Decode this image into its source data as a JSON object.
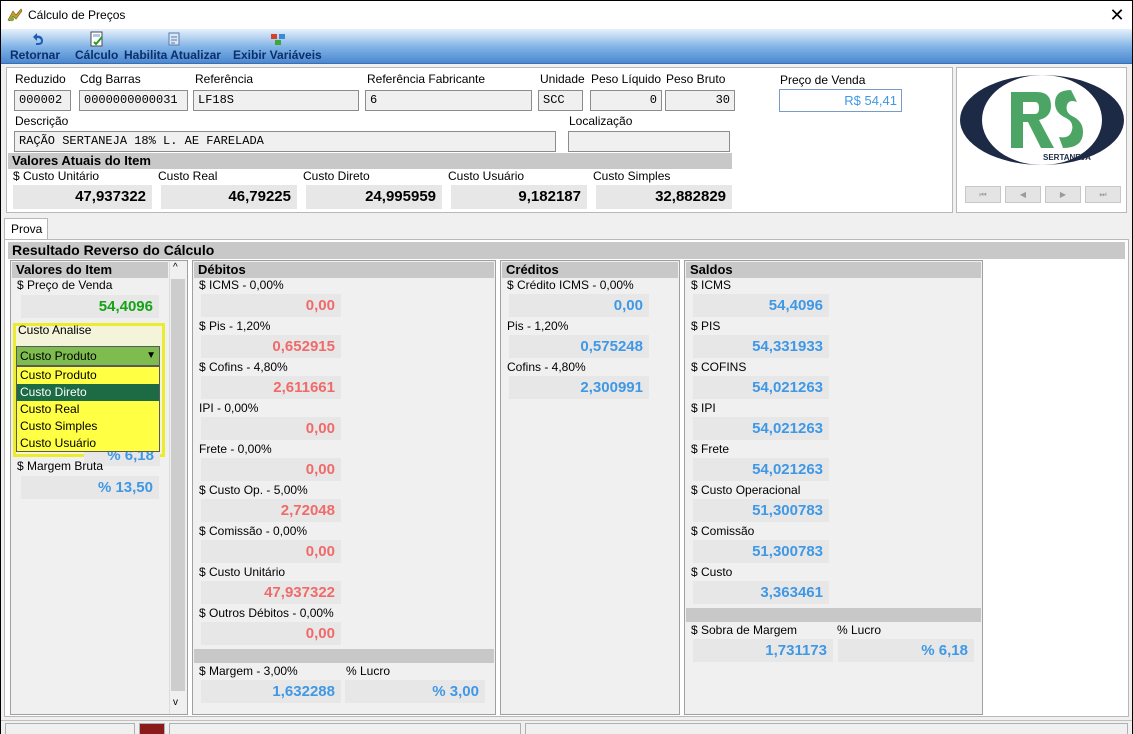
{
  "window": {
    "title": "Cálculo de Preços",
    "close_glyph": "✕"
  },
  "toolbar": [
    {
      "label": "Retornar",
      "icon": "return-arrow-icon"
    },
    {
      "label": "Cálculo",
      "icon": "calculator-icon"
    },
    {
      "label": "Habilita Atualizar",
      "icon": "enable-update-icon"
    },
    {
      "label": "Exibir Variáveis",
      "icon": "variables-icon"
    }
  ],
  "header": {
    "reduzido": {
      "label": "Reduzido",
      "value": "000002"
    },
    "cdg_barras": {
      "label": "Cdg Barras",
      "value": "0000000000031"
    },
    "referencia": {
      "label": "Referência",
      "value": "LF18S"
    },
    "ref_fabricante": {
      "label": "Referência Fabricante",
      "value": "6"
    },
    "unidade": {
      "label": "Unidade",
      "value": "SCC"
    },
    "peso_liquido": {
      "label": "Peso Líquido",
      "value": "0"
    },
    "peso_bruto": {
      "label": "Peso Bruto",
      "value": "30"
    },
    "preco_venda": {
      "label": "Preço de Venda",
      "value": "R$ 54,41"
    },
    "descricao": {
      "label": "Descrição",
      "value": "RAÇÃO SERTANEJA 18% L. AE FARELADA"
    },
    "localizacao": {
      "label": "Localização",
      "value": ""
    }
  },
  "valores_atuais": {
    "title": "Valores Atuais do Item",
    "items": [
      {
        "label": "$ Custo Unitário",
        "value": "47,937322"
      },
      {
        "label": "Custo Real",
        "value": "46,79225"
      },
      {
        "label": "Custo Direto",
        "value": "24,995959"
      },
      {
        "label": "Custo Usuário",
        "value": "9,182187"
      },
      {
        "label": "Custo Simples",
        "value": "32,882829"
      }
    ]
  },
  "logo": {
    "brand": "SERTANEJA"
  },
  "nav_buttons": [
    "⏮",
    "◀",
    "▶",
    "⏭"
  ],
  "tab": "Prova",
  "resultado": {
    "title": "Resultado Reverso do Cálculo",
    "valores_item": {
      "title": "Valores do Item",
      "preco_label": "$ Preço de Venda",
      "preco_value": "54,4096",
      "custo_analise_label": "Custo Analise",
      "combo_value": "Custo Produto",
      "options": [
        "Custo Produto",
        "Custo Direto",
        "Custo Real",
        "Custo Simples",
        "Custo Usuário"
      ],
      "selected_option": "Custo Direto",
      "partial_value": "% 6,18",
      "margem_label": "$ Margem Bruta",
      "margem_value": "% 13,50"
    },
    "debitos": {
      "title": "Débitos",
      "items": [
        {
          "label": "$ ICMS - 0,00%",
          "value": "0,00"
        },
        {
          "label": "$ Pis - 1,20%",
          "value": "0,652915"
        },
        {
          "label": "$ Cofins - 4,80%",
          "value": "2,611661"
        },
        {
          "label": "IPI - 0,00%",
          "value": "0,00"
        },
        {
          "label": "Frete - 0,00%",
          "value": "0,00"
        },
        {
          "label": "$ Custo Op. - 5,00%",
          "value": "2,72048"
        },
        {
          "label": "$ Comissão - 0,00%",
          "value": "0,00"
        },
        {
          "label": "$ Custo Unitário",
          "value": "47,937322"
        },
        {
          "label": "$ Outros Débitos - 0,00%",
          "value": "0,00"
        }
      ],
      "margem_label": "$ Margem - 3,00%",
      "margem_value": "1,632288",
      "lucro_label": "% Lucro",
      "lucro_value": "% 3,00"
    },
    "creditos": {
      "title": "Créditos",
      "items": [
        {
          "label": "$ Crédito ICMS - 0,00%",
          "value": "0,00"
        },
        {
          "label": "Pis - 1,20%",
          "value": "0,575248"
        },
        {
          "label": "Cofins - 4,80%",
          "value": "2,300991"
        }
      ]
    },
    "saldos": {
      "title": "Saldos",
      "items": [
        {
          "label": "$ ICMS",
          "value": "54,4096"
        },
        {
          "label": "$ PIS",
          "value": "54,331933"
        },
        {
          "label": "$ COFINS",
          "value": "54,021263"
        },
        {
          "label": "$ IPI",
          "value": "54,021263"
        },
        {
          "label": "$ Frete",
          "value": "54,021263"
        },
        {
          "label": "$ Custo Operacional",
          "value": "51,300783"
        },
        {
          "label": "$ Comissão",
          "value": "51,300783"
        },
        {
          "label": "$ Custo",
          "value": "3,363461"
        }
      ],
      "sobra_label": "$ Sobra de Margem",
      "sobra_value": "1,731173",
      "lucro_label": "% Lucro",
      "lucro_value": "% 6,18"
    }
  },
  "colors": {
    "debit": "#f16a6a",
    "credit": "#3f98e6",
    "price": "#15a315",
    "dropdown": "#ffff44",
    "dropdown_selected": "#1c6b45"
  }
}
